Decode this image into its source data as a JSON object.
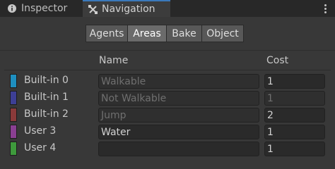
{
  "tabs": [
    {
      "label": "Inspector",
      "icon": "info-icon",
      "active": false
    },
    {
      "label": "Navigation",
      "icon": "navigation-icon",
      "active": true
    }
  ],
  "subtabs": [
    "Agents",
    "Areas",
    "Bake",
    "Object"
  ],
  "subtabs_active": "Areas",
  "table": {
    "headers": {
      "name": "Name",
      "cost": "Cost"
    },
    "rows": [
      {
        "label": "Built-in 0",
        "color": "#1e8fc0",
        "name": "Walkable",
        "name_placeholder": true,
        "cost": "1",
        "cost_disabled": false
      },
      {
        "label": "Built-in 1",
        "color": "#3d3f95",
        "name": "Not Walkable",
        "name_placeholder": true,
        "cost": "1",
        "cost_disabled": true
      },
      {
        "label": "Built-in 2",
        "color": "#8a3a3a",
        "name": "Jump",
        "name_placeholder": true,
        "cost": "2",
        "cost_disabled": false
      },
      {
        "label": "User 3",
        "color": "#8a3f92",
        "name": "Water",
        "name_placeholder": false,
        "cost": "1",
        "cost_disabled": false
      },
      {
        "label": "User 4",
        "color": "#3e9a3c",
        "name": "",
        "name_placeholder": false,
        "cost": "1",
        "cost_disabled": false
      }
    ]
  }
}
